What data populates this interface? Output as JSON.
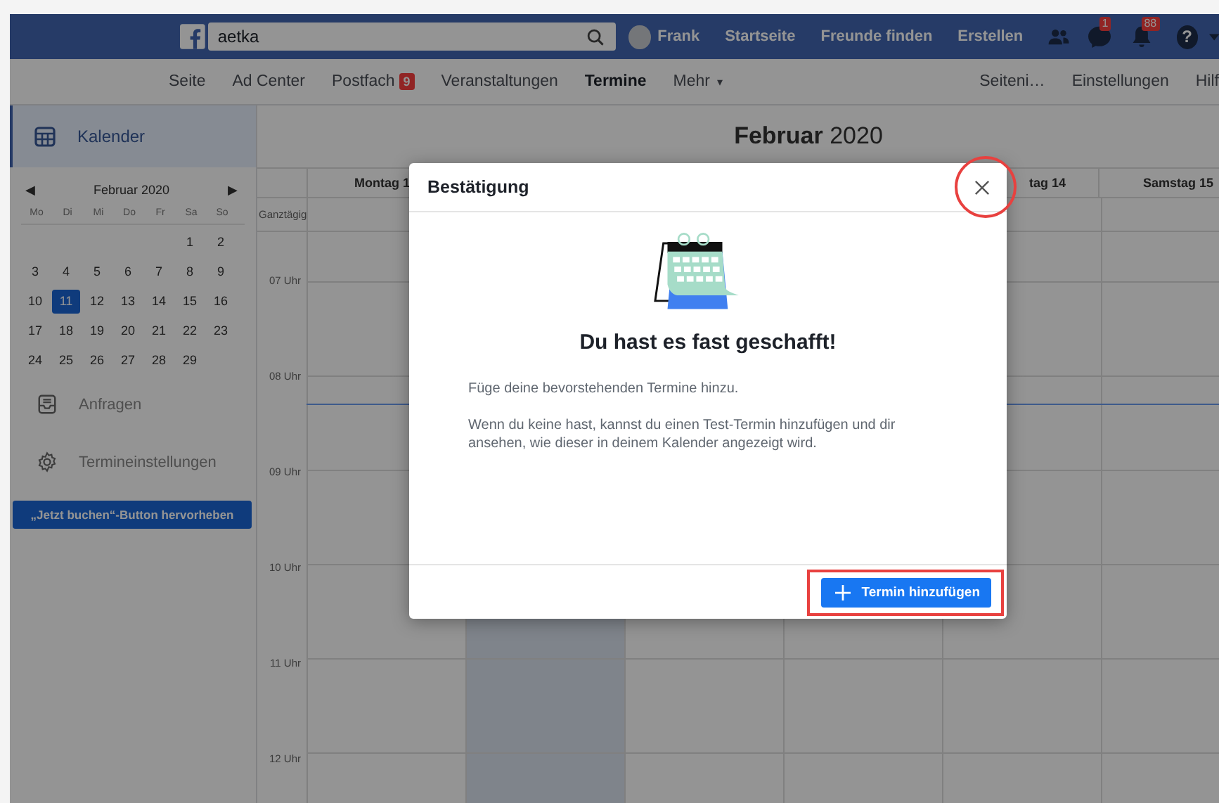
{
  "topbar": {
    "search": {
      "value": "aetka"
    },
    "user": "Frank",
    "links": [
      "Startseite",
      "Freunde finden",
      "Erstellen"
    ],
    "messages_badge": "1",
    "notifications_badge": "88",
    "help": "?"
  },
  "page_nav": {
    "items": [
      {
        "label": "Seite",
        "selected": false
      },
      {
        "label": "Ad Center",
        "selected": false
      },
      {
        "label": "Postfach",
        "selected": false,
        "badge": "9"
      },
      {
        "label": "Veranstaltungen",
        "selected": false
      },
      {
        "label": "Termine",
        "selected": true
      },
      {
        "label": "Mehr",
        "selected": false,
        "caret": "▾"
      }
    ],
    "right_items": [
      "Seiteni…",
      "Einstellungen",
      "Hilf"
    ]
  },
  "sidebar": {
    "calendar_item": {
      "label": "Kalender",
      "selected": true
    },
    "mini_calendar": {
      "prev": "◀",
      "month": "Februar 2020",
      "next": "▶",
      "weekdays": [
        "Mo",
        "Di",
        "Mi",
        "Do",
        "Fr",
        "Sa",
        "So"
      ],
      "weeks": [
        [
          {
            "d": "1",
            "selected": false
          },
          {
            "d": "2",
            "selected": false
          }
        ],
        [
          {
            "d": "3",
            "selected": false
          },
          {
            "d": "4",
            "selected": false
          },
          {
            "d": "5",
            "selected": false
          },
          {
            "d": "6",
            "selected": false
          },
          {
            "d": "7",
            "selected": false
          },
          {
            "d": "8",
            "selected": false
          },
          {
            "d": "9",
            "selected": false
          }
        ],
        [
          {
            "d": "10",
            "selected": false
          },
          {
            "d": "11",
            "selected": true
          },
          {
            "d": "12",
            "selected": false
          },
          {
            "d": "13",
            "selected": false
          },
          {
            "d": "14",
            "selected": false
          },
          {
            "d": "15",
            "selected": false
          },
          {
            "d": "16",
            "selected": false
          }
        ],
        [
          {
            "d": "17",
            "selected": false
          },
          {
            "d": "18",
            "selected": false
          },
          {
            "d": "19",
            "selected": false
          },
          {
            "d": "20",
            "selected": false
          },
          {
            "d": "21",
            "selected": false
          },
          {
            "d": "22",
            "selected": false
          },
          {
            "d": "23",
            "selected": false
          }
        ],
        [
          {
            "d": "24",
            "selected": false
          },
          {
            "d": "25",
            "selected": false
          },
          {
            "d": "26",
            "selected": false
          },
          {
            "d": "27",
            "selected": false
          },
          {
            "d": "28",
            "selected": false
          },
          {
            "d": "29",
            "selected": false
          }
        ]
      ]
    },
    "items": [
      {
        "kind": "inbox",
        "label": "Anfragen",
        "selected": false
      },
      {
        "kind": "gear",
        "label": "Termineinstellungen",
        "selected": false
      }
    ],
    "promo_button": "„Jetzt buchen“-Button hervorheben"
  },
  "calendar": {
    "title": "**Februar** 2020",
    "all_day": "Ganztägig",
    "columns": [
      {
        "header": "Montag 1",
        "today": false
      },
      {
        "today": true
      },
      {
        "today": false
      },
      {
        "today": false
      },
      {
        "header": "tag 14",
        "today": false
      },
      {
        "header": "Samstag 15",
        "today": false
      }
    ],
    "hours": [
      "07 Uhr",
      "08 Uhr",
      "09 Uhr",
      "10 Uhr",
      "11 Uhr",
      "12 Uhr"
    ],
    "now_line": true
  },
  "dialog": {
    "title": "Bestätigung",
    "close_highlighted": true,
    "heading": "Du hast es fast geschafft!",
    "paragraphs": [
      "Füge deine bevorstehenden Termine hinzu.",
      "Wenn du keine hast, kannst du einen Test-Termin hinzufügen und dir ansehen, wie dieser in deinem Kalender angezeigt wird."
    ],
    "button": "Termin hinzufügen",
    "button_highlighted": true
  }
}
